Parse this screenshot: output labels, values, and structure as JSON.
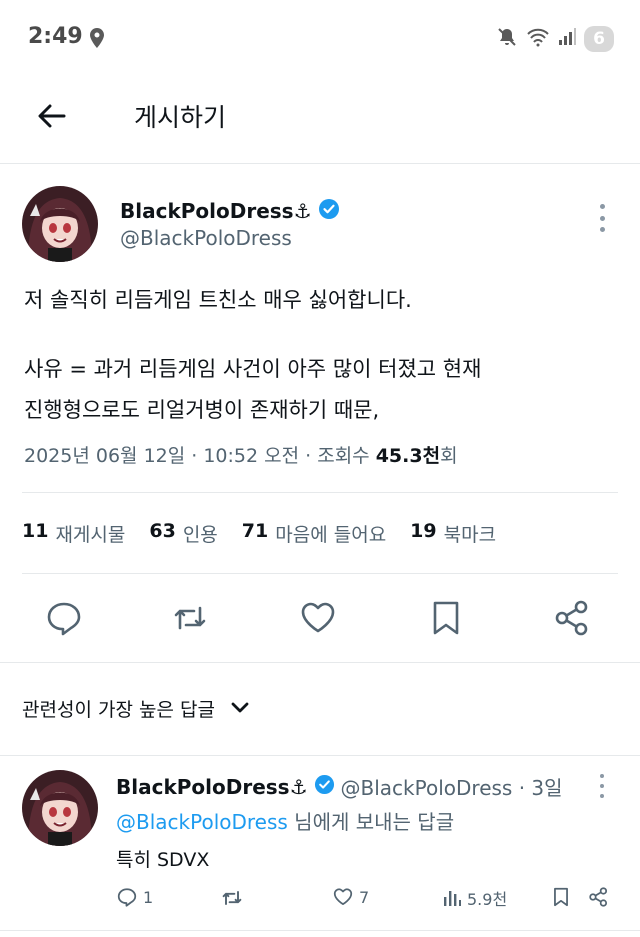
{
  "status_bar": {
    "time": "2:49",
    "notification_count": "6"
  },
  "header": {
    "title": "게시하기"
  },
  "post": {
    "display_name": "BlackPoloDress⚓",
    "handle": "@BlackPoloDress",
    "text_lines": [
      "저 솔직히 리듬게임 트친소 매우 싫어합니다.",
      "사유 = 과거 리듬게임 사건이 아주 많이 터졌고 현재",
      "진행형으로도 리얼거병이 존재하기 때문,"
    ],
    "date": "2025년 06월 12일 · 10:52 오전 · 조회수 ",
    "views_num": "45.3천",
    "views_suffix": "회"
  },
  "stats": {
    "reposts": {
      "num": "11",
      "label": "재게시물"
    },
    "quotes": {
      "num": "63",
      "label": "인용"
    },
    "likes": {
      "num": "71",
      "label": "마음에 들어요"
    },
    "bookmarks": {
      "num": "19",
      "label": "북마크"
    }
  },
  "sort": {
    "label": "관련성이 가장 높은 답글"
  },
  "reply": {
    "display_name": "BlackPoloDress⚓",
    "handle_time": "@BlackPoloDress · 3일",
    "mention": "@BlackPoloDress",
    "reply_to_suffix": " 님에게 보내는 답글",
    "text": "특히 SDVX",
    "replies": "1",
    "likes": "7",
    "views": "5.9천"
  },
  "icons": {
    "verified_badge": "verified-icon",
    "accent": "#1d9bf0"
  }
}
